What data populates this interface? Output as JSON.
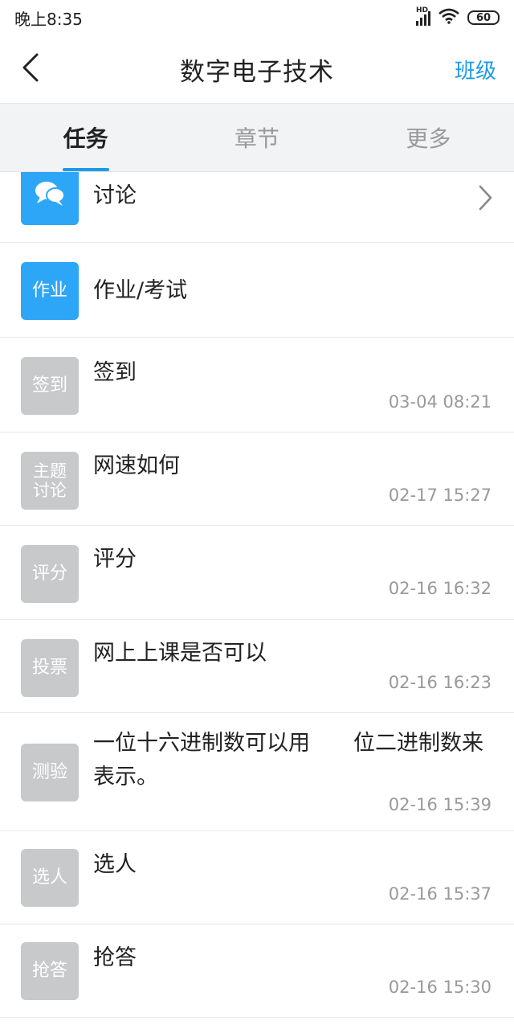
{
  "status_bar": {
    "time": "晚上8:35",
    "battery": "60",
    "network": "HD"
  },
  "header": {
    "title": "数字电子技术",
    "right_link": "班级"
  },
  "tabs": [
    {
      "label": "任务",
      "active": true
    },
    {
      "label": "章节",
      "active": false
    },
    {
      "label": "更多",
      "active": false
    }
  ],
  "colors": {
    "accent": "#1a9be8",
    "badge_active": "#2ea6f7",
    "badge_inactive": "#c7c9cb"
  },
  "list": [
    {
      "badge_icon": "chat-bubbles-icon",
      "title": "讨论",
      "time": ""
    },
    {
      "badge": "作业",
      "title": "作业/考试",
      "time": ""
    },
    {
      "badge": "签到",
      "title": "签到",
      "time": "03-04 08:21"
    },
    {
      "badge": "主题\n讨论",
      "title": "网速如何",
      "time": "02-17 15:27"
    },
    {
      "badge": "评分",
      "title": "评分",
      "time": "02-16 16:32"
    },
    {
      "badge": "投票",
      "title": "网上上课是否可以",
      "time": "02-16 16:23"
    },
    {
      "badge": "测验",
      "title_line1": "一位十六进制数可以用　　位二进制数来",
      "title_line2": "表示。",
      "time": "02-16 15:39"
    },
    {
      "badge": "选人",
      "title": "选人",
      "time": "02-16 15:37"
    },
    {
      "badge": "抢答",
      "title": "抢答",
      "time": "02-16 15:30"
    }
  ]
}
